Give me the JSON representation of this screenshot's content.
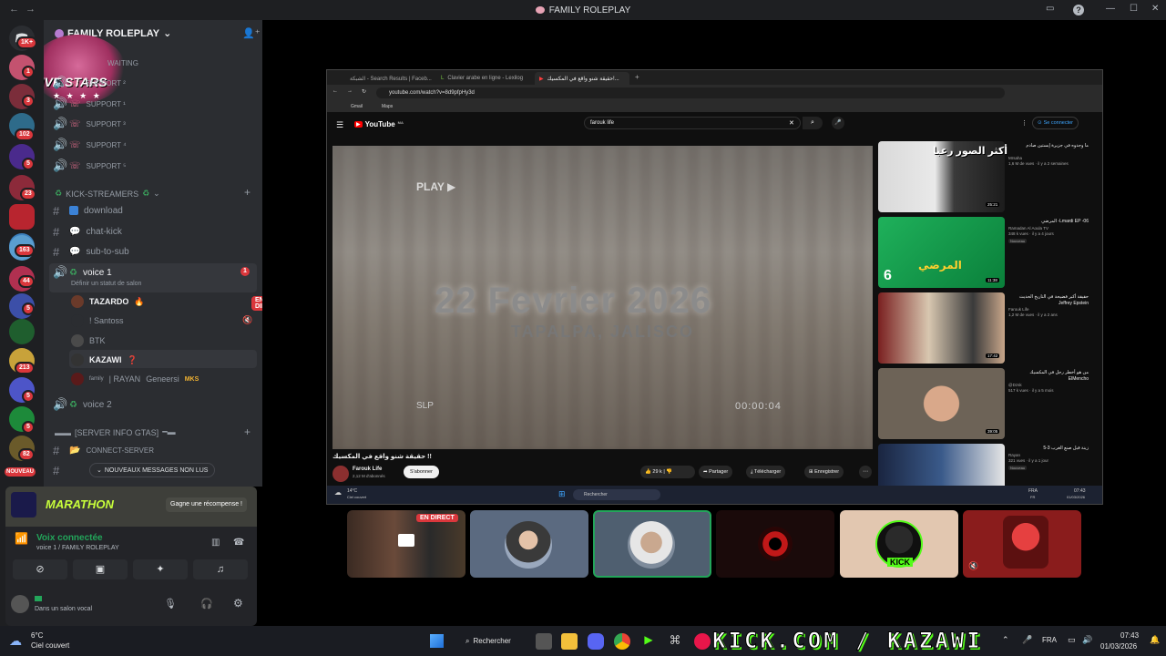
{
  "window": {
    "title": "FAMILY ROLEPLAY"
  },
  "rail": {
    "badges": [
      "1K+",
      "1",
      "3",
      "102",
      "5",
      "23",
      "5",
      "163",
      "44",
      "5",
      "213",
      "5",
      "5",
      "82"
    ],
    "new_label": "NOUVEAU"
  },
  "guild": {
    "name": "FAMILY ROLEPLAY",
    "logo_text": "FIVE STARS"
  },
  "channels": {
    "waiting": "WAITING",
    "support": [
      "SUPPORT ¹",
      "SUPPORT ²",
      "SUPPORT ³",
      "SUPPORT ⁴",
      "SUPPORT ⁵"
    ],
    "category": "KICK-STREAMERS",
    "text": [
      "download",
      "chat-kick",
      "sub-to-sub"
    ],
    "voice1": "voice 1",
    "voice1_badge": "1",
    "voice1_status": "Définir un statut de salon",
    "voice_users": [
      {
        "name": "TAZARDO",
        "live": "EN DIRECT"
      },
      {
        "name": "! Santoss"
      },
      {
        "name": "BTK"
      },
      {
        "name": "KAZAWI"
      },
      {
        "name": "| RAYAN",
        "tag": "Geneersi",
        "role": "MKS",
        "prefix": "family"
      }
    ],
    "voice2": "voice 2",
    "server_info": "[SERVER INFO GTAS]",
    "connect": "CONNECT-SERVER",
    "new_msgs": "NOUVEAUX MESSAGES NON LUS"
  },
  "promo": {
    "title": "MARATHON",
    "button": "Gagne une récompense !"
  },
  "voice_panel": {
    "status": "Voix connectée",
    "channel": "voice 1 / FAMILY ROLEPLAY"
  },
  "user": {
    "status": "Dans un salon vocal"
  },
  "browser": {
    "tabs": [
      "الشبكة - Search Results | Faceb...",
      "Clavier arabe en ligne - Lexilog",
      "حقيقة شنو واقع في المكسيك!..."
    ],
    "url": "youtube.com/watch?v=8d9pfpHy3d",
    "bookmarks": [
      "Gmail",
      "Maps"
    ]
  },
  "youtube": {
    "logo": "YouTube",
    "country": "MA",
    "search": "farouk life",
    "signin": "Se connecter",
    "video_overlay": {
      "play": "PLAY ▶",
      "date": "22 Fevrier 2026",
      "place": "TAPALPA, JALISCO",
      "slp": "SLP",
      "timer": "00:00:04"
    },
    "video_title": "حقيقة شنو واقع في المكسيك !!",
    "channel": "Farouk Life",
    "subs": "2,12 M d'abonnés",
    "subscribe": "S'abonner",
    "likes": "29 k",
    "actions": [
      "Partager",
      "Télécharger",
      "Enregistrer"
    ],
    "recs": [
      {
        "title": "ما وجدوه في جزيرة إبستين صادم",
        "channel": "Mrsaha",
        "meta": "1,6 M de vues · il y a 2 semaines",
        "duration": "25:21",
        "thumb_text": "أكثر الصور رعبا"
      },
      {
        "title": "Lmardi EP -06- المرضي",
        "channel": "Ramadan Al Aoula TV",
        "meta": "348 k vues · il y a 4 jours",
        "duration": "11:38",
        "badge": "Nouveau",
        "thumb_text": "المرضي",
        "thumb_num": "6"
      },
      {
        "title": "حقيقة أكبر فضيحة في التاريخ الحديث Jeffrey Epstein",
        "channel": "Farouk Life",
        "meta": "1,2 M de vues · il y a 2 ans",
        "duration": "17:42"
      },
      {
        "title": "من هو أخطر رجل في المكسيك ElMencho",
        "channel": "@Dzsk",
        "meta": "517 k vues · il y a 5 mois",
        "duration": "39:05"
      },
      {
        "title": "زينة قبل صنع الغرب 3-5",
        "channel": "Rayan",
        "meta": "321 vues · il y a 1 jour",
        "badge": "Nouveau"
      }
    ]
  },
  "win_taskbar": {
    "weather": "14°C",
    "weather_desc": "Ciel couvert",
    "search": "Rechercher",
    "lang": "FRA",
    "lang2": "FR",
    "time": "07:43",
    "date": "01/03/2026"
  },
  "tiles": {
    "live": "EN DIRECT",
    "kick": "KICK"
  },
  "os_taskbar": {
    "temp": "6°C",
    "weather": "Ciel couvert",
    "search": "Rechercher",
    "overlay": "KICK.COM / KAZAWI",
    "lang": "FRA",
    "time": "07:43",
    "date": "01/03/2026"
  }
}
